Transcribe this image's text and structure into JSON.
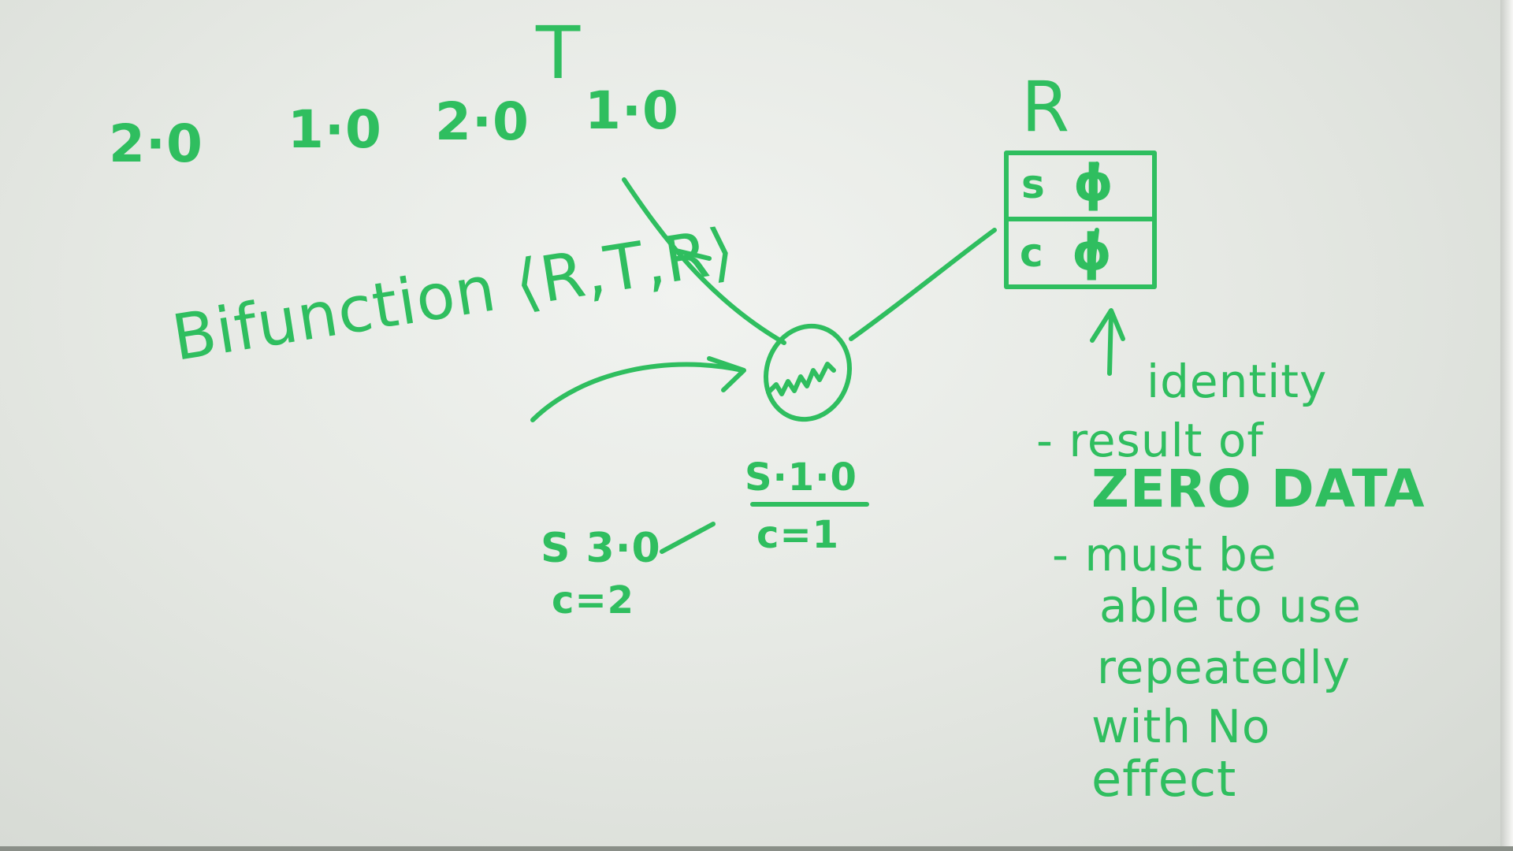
{
  "board": {
    "timeline_label": "T",
    "timeline_values": [
      "2·0",
      "1·0",
      "2·0",
      "1·0"
    ],
    "reduction_label": "R",
    "reduction_table": [
      {
        "key": "s",
        "value": "ϕ"
      },
      {
        "key": "c",
        "value": "ϕ"
      }
    ],
    "bifunction_text": "Bifunction ⟨R,T,R⟩",
    "node_state_top": "S·1·0",
    "node_state_bottom": "c=1",
    "input_state_top": "S 3·0",
    "input_state_bottom": "c=2",
    "notes": {
      "title": "identity",
      "line1": "- result of",
      "line2": "ZERO DATA",
      "line3": "- must be",
      "line4": "able to use",
      "line5": "repeatedly",
      "line6": "with No",
      "line7": "effect"
    }
  },
  "colors": {
    "ink": "#2fbe5f",
    "board": "#e6e9e4"
  }
}
